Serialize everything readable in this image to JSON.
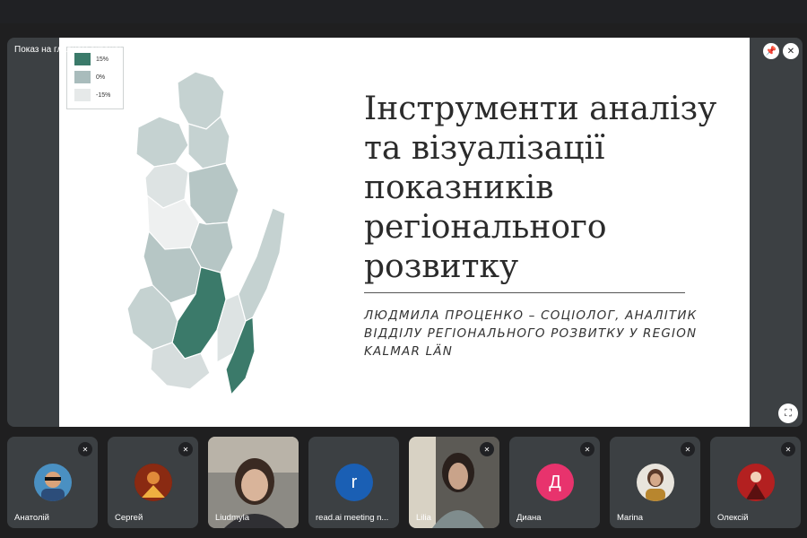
{
  "stage": {
    "presenter_label": "Показ на главном экране: Ludmyla Protsenko"
  },
  "slide": {
    "title_lines": [
      "Інструменти аналізу",
      "та візуалізації",
      "показників",
      "регіонального",
      "розвитку"
    ],
    "subtitle_lines": [
      "ЛЮДМИЛА ПРОЦЕНКО – СОЦІОЛОГ, АНАЛІТИК",
      "ВІДДІЛУ РЕГІОНАЛЬНОГО РОЗВИТКУ У REGION",
      "KALMAR LÄN"
    ],
    "legend": [
      {
        "label": "15%",
        "color": "#3b7a6a"
      },
      {
        "label": "0%",
        "color": "#a9bcbc"
      },
      {
        "label": "-15%",
        "color": "#e6e9e9"
      }
    ]
  },
  "participants": [
    {
      "name": "Анатолій",
      "muted": true,
      "avatar": "photo"
    },
    {
      "name": "Сергей",
      "muted": true,
      "avatar": "photo"
    },
    {
      "name": "Liudmyla",
      "muted": false,
      "avatar": "video",
      "speaking": true
    },
    {
      "name": "read.ai meeting n...",
      "muted": false,
      "avatar": "letter",
      "letter": "r",
      "color": "#1a5fb4"
    },
    {
      "name": "Lilia",
      "muted": true,
      "avatar": "video"
    },
    {
      "name": "Диана",
      "muted": true,
      "avatar": "letter",
      "letter": "Д",
      "color": "#e8336d"
    },
    {
      "name": "Marina",
      "muted": true,
      "avatar": "photo"
    },
    {
      "name": "Олексій",
      "muted": true,
      "avatar": "photo"
    }
  ],
  "icons": {
    "pin": "pin-icon",
    "mic_off": "mic-off-icon",
    "fullscreen": "fullscreen-icon"
  }
}
